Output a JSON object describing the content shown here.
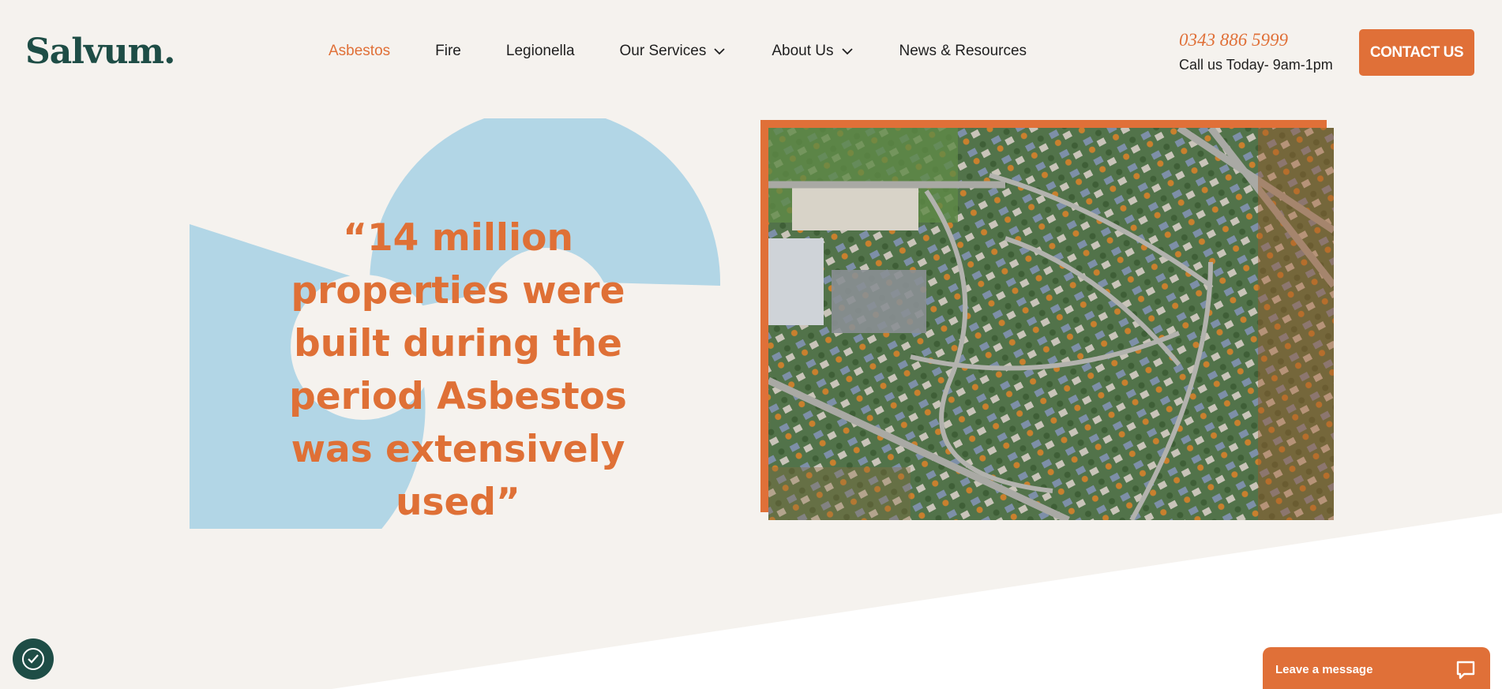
{
  "brand": {
    "logo_text": "Salvum."
  },
  "nav": {
    "items": [
      {
        "label": "Asbestos",
        "active": true,
        "dropdown": false
      },
      {
        "label": "Fire",
        "active": false,
        "dropdown": false
      },
      {
        "label": "Legionella",
        "active": false,
        "dropdown": false
      },
      {
        "label": "Our Services",
        "active": false,
        "dropdown": true
      },
      {
        "label": "About Us",
        "active": false,
        "dropdown": true
      },
      {
        "label": "News & Resources",
        "active": false,
        "dropdown": false
      }
    ]
  },
  "contact": {
    "phone": "0343 886 5999",
    "hours": "Call us Today- 9am-1pm",
    "button_label": "CONTACT US"
  },
  "hero": {
    "quote": "“14 million properties were built during the period Asbestos was extensively used”",
    "image_subject": "aerial view of suburban housing estate"
  },
  "chat": {
    "label": "Leave a message"
  },
  "colors": {
    "accent": "#e07038",
    "brand_green": "#1e4d46",
    "shape_blue": "#b2d6e6",
    "background": "#f5f2ee"
  },
  "icons": {
    "dropdown": "chevron-down-icon",
    "cookie": "cookie-consent-icon",
    "chat": "chat-bubble-icon"
  }
}
